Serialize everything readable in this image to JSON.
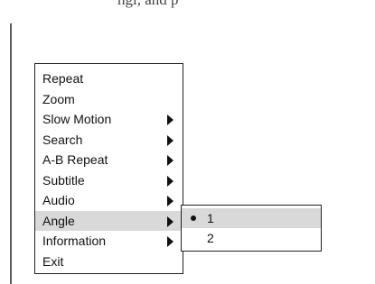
{
  "page": {
    "top_text": "ngl, and p"
  },
  "menu": {
    "items": [
      {
        "label": "Repeat",
        "has_submenu": false,
        "selected": false
      },
      {
        "label": "Zoom",
        "has_submenu": false,
        "selected": false
      },
      {
        "label": "Slow Motion",
        "has_submenu": true,
        "selected": false
      },
      {
        "label": "Search",
        "has_submenu": true,
        "selected": false
      },
      {
        "label": "A-B Repeat",
        "has_submenu": true,
        "selected": false
      },
      {
        "label": "Subtitle",
        "has_submenu": true,
        "selected": false
      },
      {
        "label": "Audio",
        "has_submenu": true,
        "selected": false
      },
      {
        "label": "Angle",
        "has_submenu": true,
        "selected": true
      },
      {
        "label": "Information",
        "has_submenu": true,
        "selected": false
      },
      {
        "label": "Exit",
        "has_submenu": false,
        "selected": false
      }
    ],
    "submenu_icon": "triangle-right-icon"
  },
  "angle_submenu": {
    "items": [
      {
        "label": "1",
        "selected": true,
        "bullet": true
      },
      {
        "label": "2",
        "selected": false,
        "bullet": false
      }
    ],
    "bullet_icon": "bullet-dot-icon"
  },
  "colors": {
    "selected_background": "#d9d9d9",
    "border": "#222222",
    "text": "#111111"
  }
}
